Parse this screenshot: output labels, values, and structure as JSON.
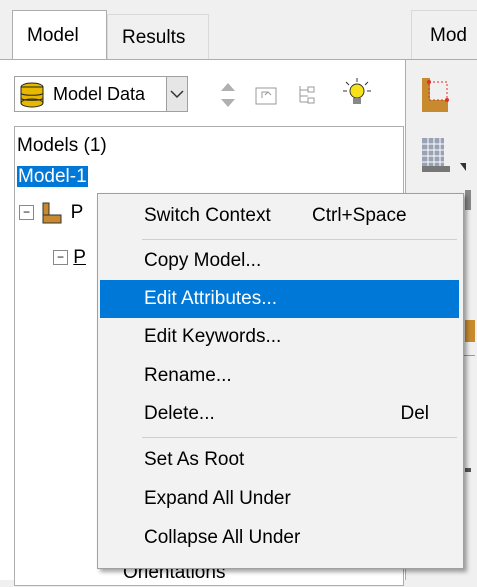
{
  "tabs": {
    "model": "Model",
    "results": "Results",
    "module": "Mod"
  },
  "toolbar": {
    "combo_value": "Model Data"
  },
  "tree": {
    "models_header": "Models (1)",
    "model_item": "Model-1",
    "row_p1": "P",
    "row_p2": "P",
    "bottom_item": "Orientations"
  },
  "context_menu": {
    "items": [
      {
        "label": "Switch Context",
        "shortcut": "Ctrl+Space"
      },
      {
        "label": "Copy Model...",
        "shortcut": ""
      },
      {
        "label": "Edit Attributes...",
        "shortcut": "",
        "highlighted": true
      },
      {
        "label": "Edit Keywords...",
        "shortcut": ""
      },
      {
        "label": "Rename...",
        "shortcut": ""
      },
      {
        "label": "Delete...",
        "shortcut": "Del"
      },
      {
        "label": "Set As Root",
        "shortcut": ""
      },
      {
        "label": "Expand All Under",
        "shortcut": ""
      },
      {
        "label": "Collapse All Under",
        "shortcut": ""
      }
    ]
  },
  "colors": {
    "highlight": "#0078d7",
    "menu_bg": "#f2f2f2"
  }
}
